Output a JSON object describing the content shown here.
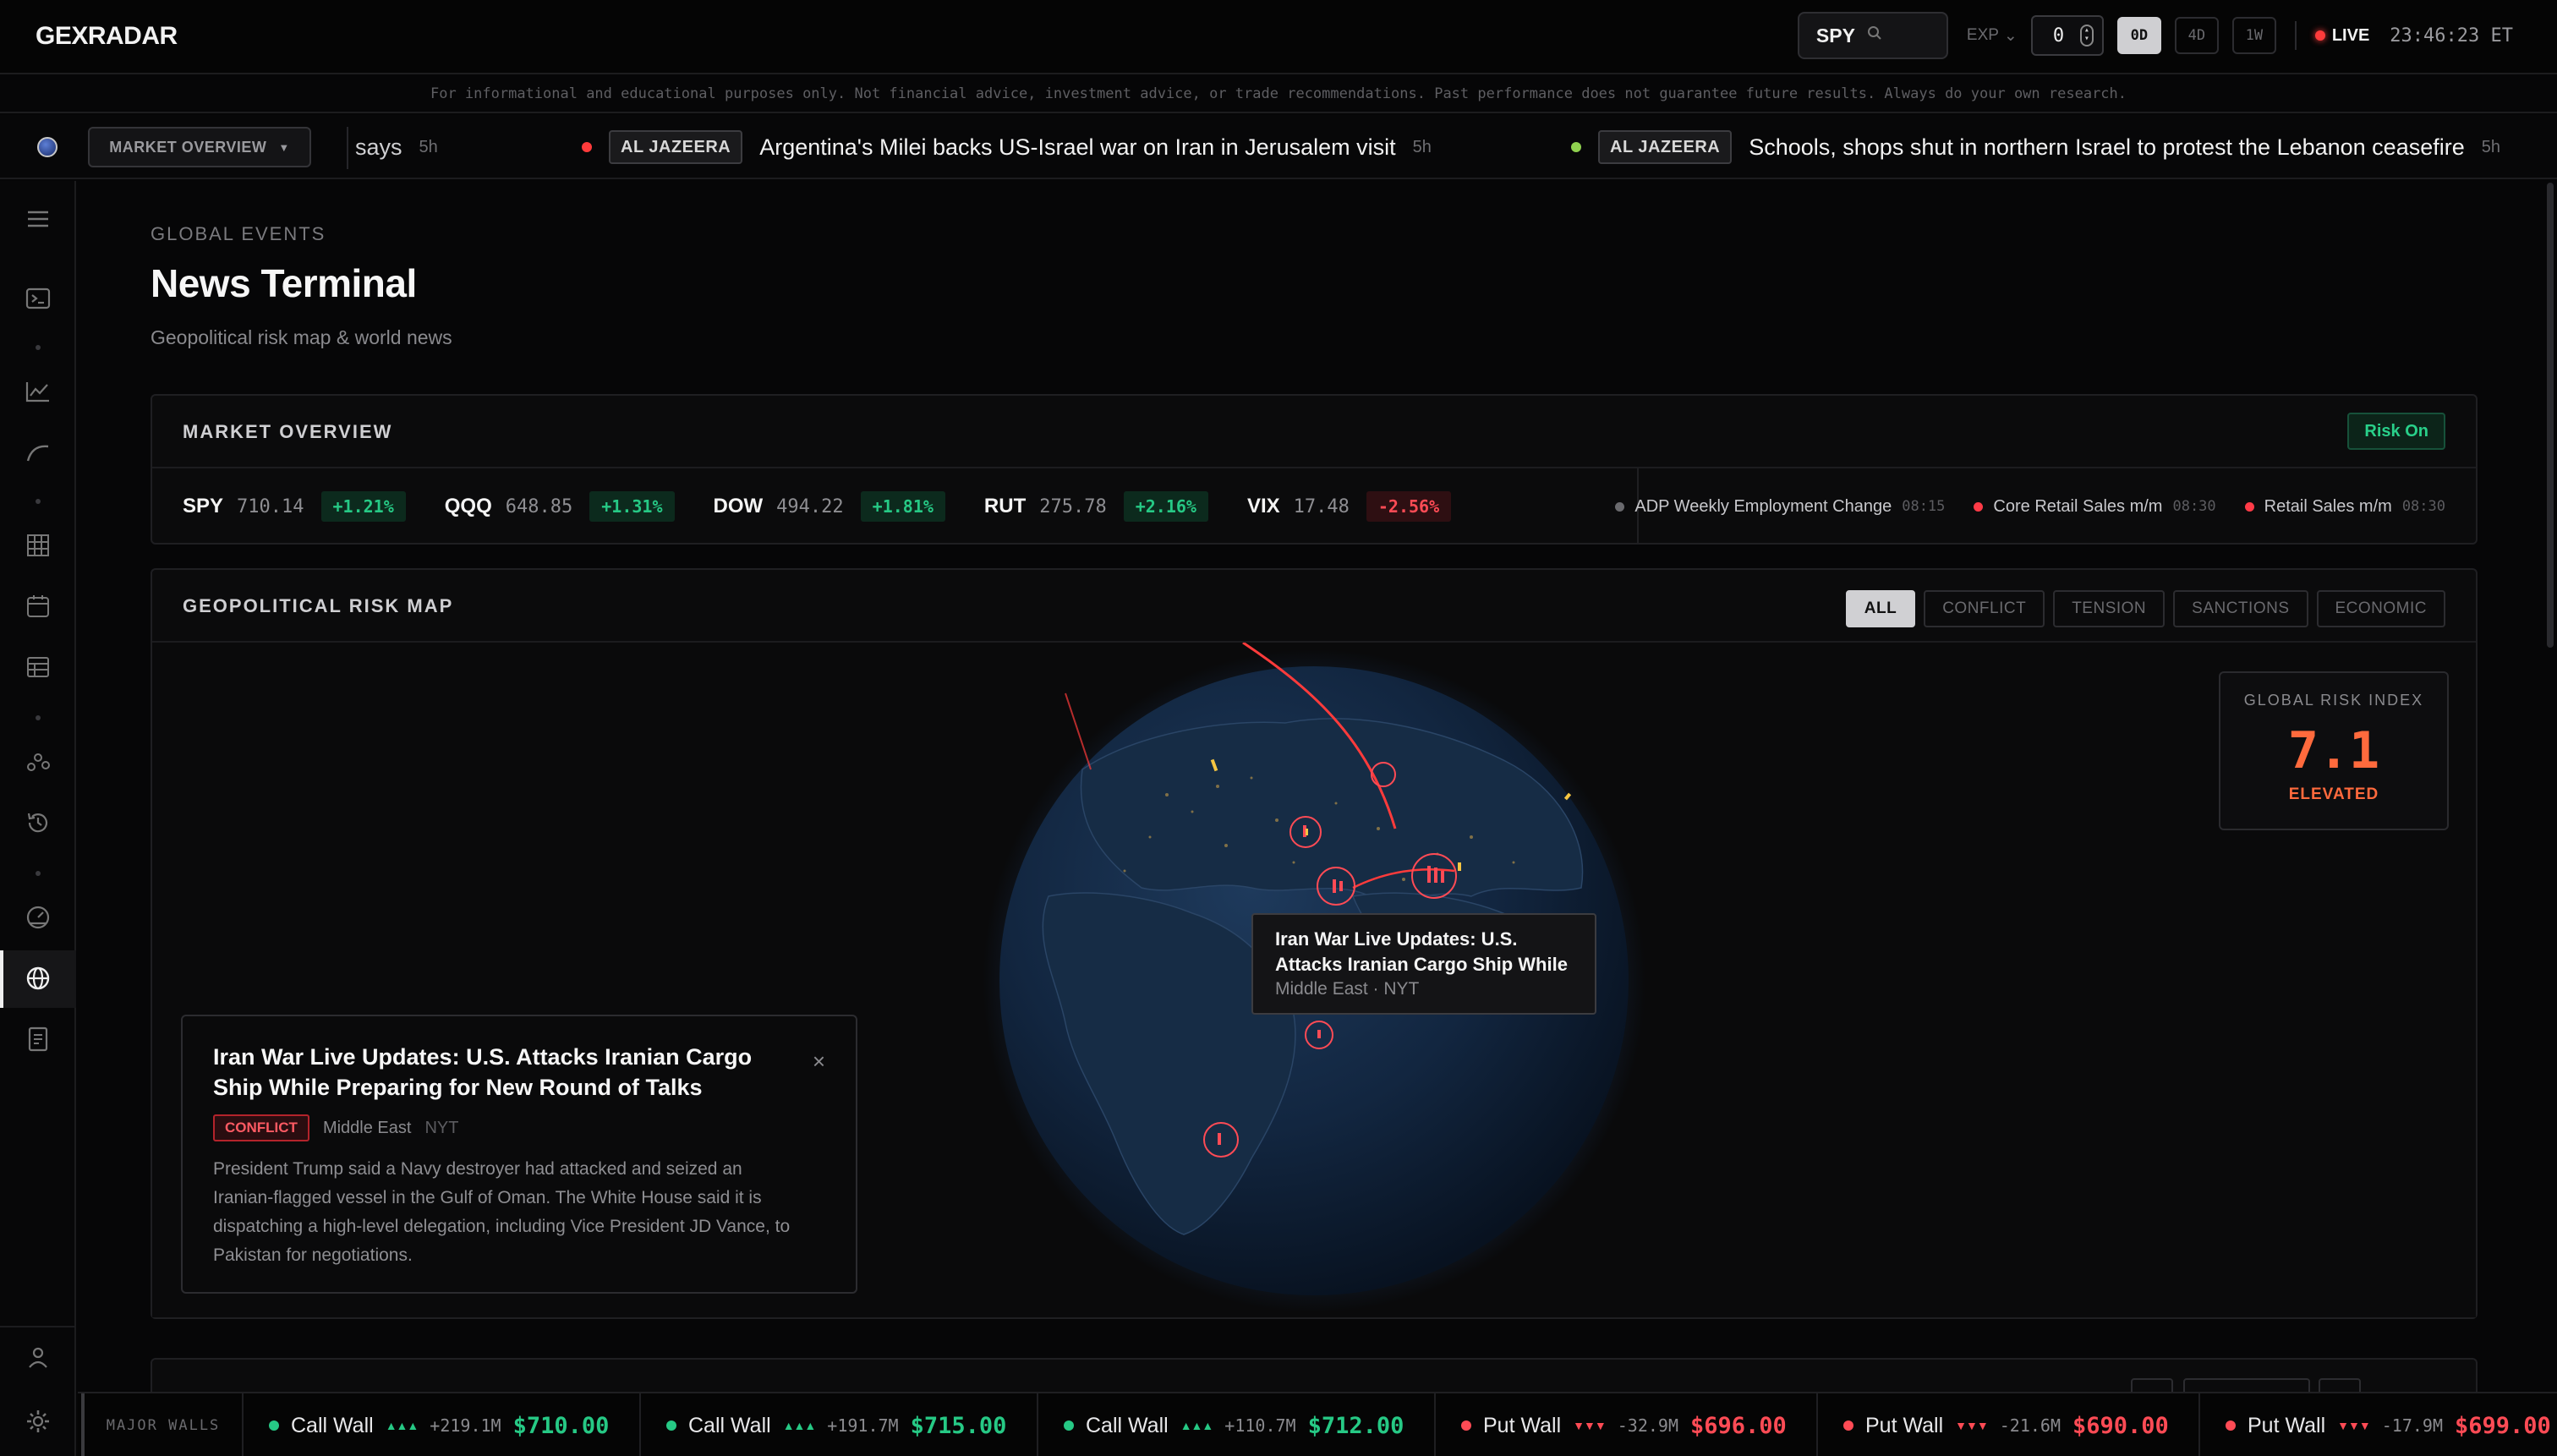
{
  "app": {
    "logo": "GEXRADAR"
  },
  "topbar": {
    "ticker": "SPY",
    "exp_label": "EXP",
    "exp_value": "0",
    "ranges": [
      "0D",
      "4D",
      "1W"
    ],
    "active_range": "0D",
    "live_label": "LIVE",
    "clock": "23:46:23 ET"
  },
  "disclaimer": "For informational and educational purposes only. Not financial advice, investment advice, or trade recommendations. Past performance does not guarantee future results. Always do your own research.",
  "newsbar": {
    "dropdown_label": "MARKET OVERVIEW",
    "items": [
      {
        "title": "says",
        "age": "5h",
        "source": "",
        "dot": ""
      },
      {
        "source": "AL JAZEERA",
        "title": "Argentina's Milei backs US-Israel war on Iran in Jerusalem visit",
        "age": "5h",
        "dot": "#ff3b3b"
      },
      {
        "source": "AL JAZEERA",
        "title": "Schools, shops shut in northern Israel to protest the Lebanon ceasefire",
        "age": "5h",
        "dot": "#8fd14f"
      }
    ]
  },
  "page": {
    "eyebrow": "GLOBAL EVENTS",
    "title": "News Terminal",
    "subtitle": "Geopolitical risk map & world news"
  },
  "market_overview": {
    "title": "MARKET OVERVIEW",
    "regime": "Risk On",
    "indices": [
      {
        "sym": "SPY",
        "price": "710.14",
        "chg": "+1.21%",
        "dir": "up"
      },
      {
        "sym": "QQQ",
        "price": "648.85",
        "chg": "+1.31%",
        "dir": "up"
      },
      {
        "sym": "DOW",
        "price": "494.22",
        "chg": "+1.81%",
        "dir": "up"
      },
      {
        "sym": "RUT",
        "price": "275.78",
        "chg": "+2.16%",
        "dir": "up"
      },
      {
        "sym": "VIX",
        "price": "17.48",
        "chg": "-2.56%",
        "dir": "dn"
      }
    ],
    "events": [
      {
        "name": "ADP Weekly Employment Change",
        "time": "08:15",
        "color": "#6a6a6e"
      },
      {
        "name": "Core Retail Sales m/m",
        "time": "08:30",
        "color": "#ff3b47"
      },
      {
        "name": "Retail Sales m/m",
        "time": "08:30",
        "color": "#ff3b47"
      }
    ]
  },
  "risk_map": {
    "title": "GEOPOLITICAL RISK MAP",
    "filters": [
      "ALL",
      "CONFLICT",
      "TENSION",
      "SANCTIONS",
      "ECONOMIC"
    ],
    "active_filter": "ALL",
    "index": {
      "label": "GLOBAL RISK INDEX",
      "value": "7.1",
      "status": "ELEVATED",
      "color": "#ff6a3d"
    },
    "tooltip": {
      "title": "Iran War Live Updates: U.S. Attacks Iranian Cargo Ship While",
      "meta": "Middle East · NYT"
    },
    "detail": {
      "title": "Iran War Live Updates: U.S. Attacks Iranian Cargo Ship While Preparing for New Round of Talks",
      "tag": "CONFLICT",
      "region": "Middle East",
      "source": "NYT",
      "body": "President Trump said a Navy destroyer had attacked and seized an Iranian-flagged vessel in the Gulf of Oman. The White House said it is dispatching a high-level delegation, including Vice President JD Vance, to Pakistan for negotiations.",
      "close": "×"
    }
  },
  "walls": {
    "label": "MAJOR WALLS",
    "items": [
      {
        "name": "Call Wall",
        "arrows": "▲▲▲",
        "amount": "+219.1M",
        "price": "$710.00",
        "type": "call"
      },
      {
        "name": "Call Wall",
        "arrows": "▲▲▲",
        "amount": "+191.7M",
        "price": "$715.00",
        "type": "call"
      },
      {
        "name": "Call Wall",
        "arrows": "▲▲▲",
        "amount": "+110.7M",
        "price": "$712.00",
        "type": "call"
      },
      {
        "name": "Put Wall",
        "arrows": "▼▼▼",
        "amount": "-32.9M",
        "price": "$696.00",
        "type": "put"
      },
      {
        "name": "Put Wall",
        "arrows": "▼▼▼",
        "amount": "-21.6M",
        "price": "$690.00",
        "type": "put"
      },
      {
        "name": "Put Wall",
        "arrows": "▼▼▼",
        "amount": "-17.9M",
        "price": "$699.00",
        "type": "put"
      }
    ]
  },
  "colors": {
    "call": "#26c985",
    "put": "#ff4b55",
    "accent": "#ff3b3b"
  }
}
